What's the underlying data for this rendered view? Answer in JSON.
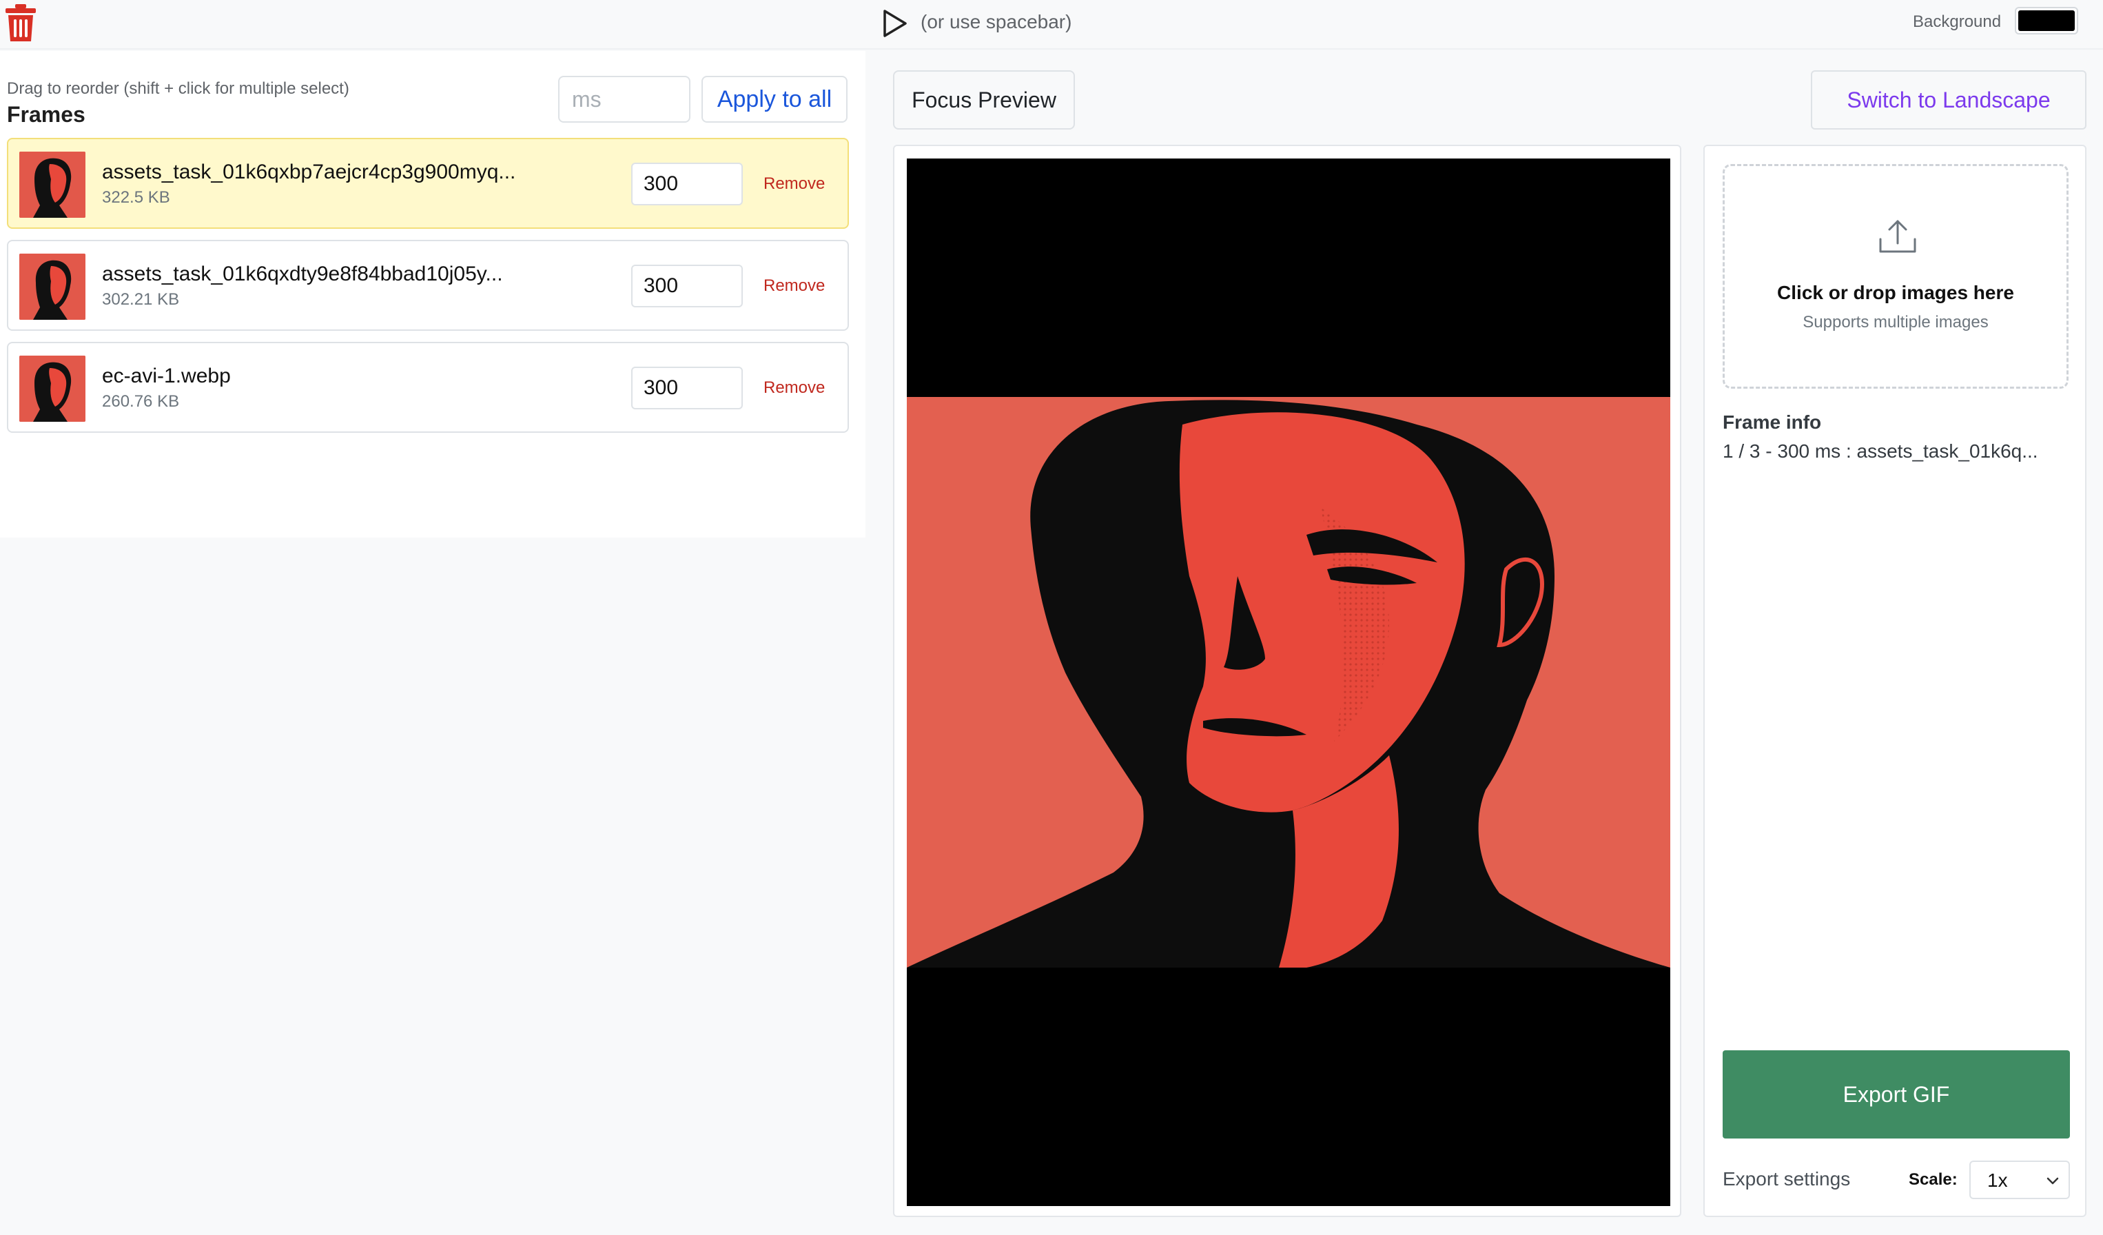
{
  "toolbar": {
    "play_hint": "(or use spacebar)",
    "background_label": "Background",
    "background_color": "#000000"
  },
  "frames_panel": {
    "hint": "Drag to reorder (shift + click for multiple select)",
    "title": "Frames",
    "ms_placeholder": "ms",
    "apply_label": "Apply to all",
    "items": [
      {
        "name": "assets_task_01k6qxbp7aejcr4cp3g900myq...",
        "size": "322.5 KB",
        "duration": "300",
        "remove_label": "Remove",
        "selected": true
      },
      {
        "name": "assets_task_01k6qxdty9e8f84bbad10j05y...",
        "size": "302.21 KB",
        "duration": "300",
        "remove_label": "Remove",
        "selected": false
      },
      {
        "name": "ec-avi-1.webp",
        "size": "260.76 KB",
        "duration": "300",
        "remove_label": "Remove",
        "selected": false
      }
    ]
  },
  "preview": {
    "focus_label": "Focus Preview",
    "orientation_label": "Switch to Landscape"
  },
  "side": {
    "drop_title": "Click or drop images here",
    "drop_subtitle": "Supports multiple images",
    "frame_info_title": "Frame info",
    "frame_info_text": "1 / 3 - 300 ms : assets_task_01k6q...",
    "export_label": "Export GIF",
    "export_settings_label": "Export settings",
    "scale_label": "Scale:",
    "scale_value": "1x"
  },
  "colors": {
    "accent_blue": "#1a56db",
    "accent_purple": "#7c3aed",
    "export_green": "#3f8c63",
    "remove_red": "#c0281e",
    "trash_red": "#d93025",
    "selected_row": "#fff9cc"
  }
}
